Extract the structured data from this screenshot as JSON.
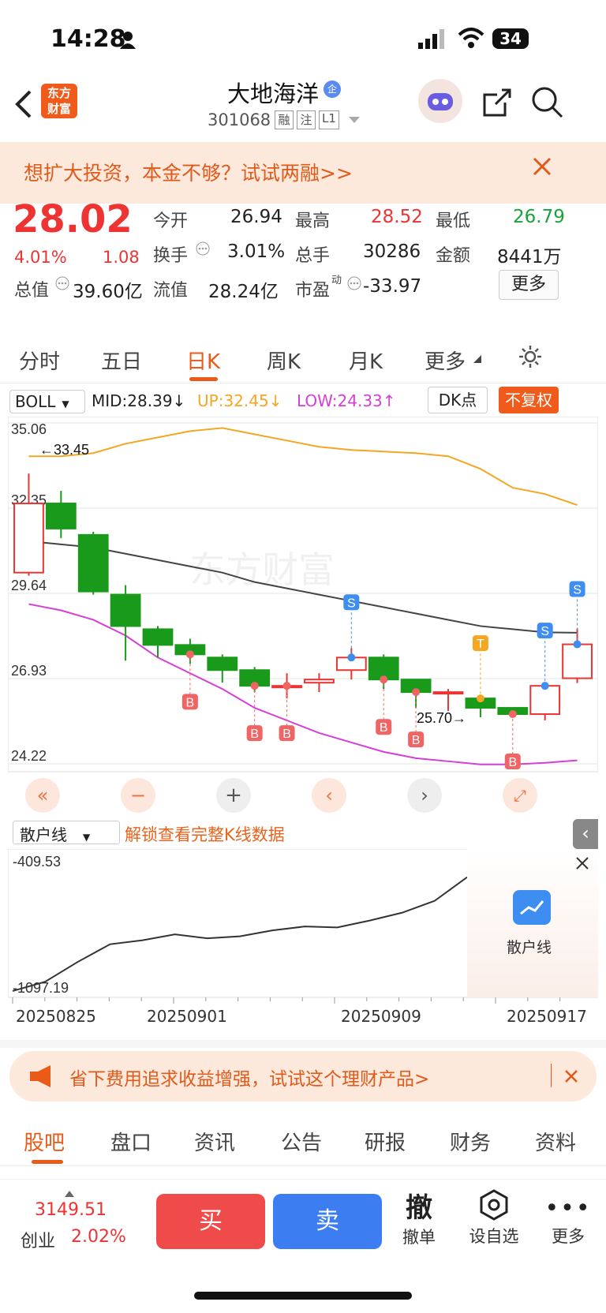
{
  "status": {
    "time": "14:28",
    "battery": "34"
  },
  "header": {
    "logo_line1": "东方",
    "logo_line2": "财富",
    "title": "大地海洋",
    "title_badge": "企",
    "code": "301068",
    "tag1": "融",
    "tag2": "注",
    "tag3": "L1"
  },
  "banner": {
    "text": "想扩大投资，本金不够？试试两融>>"
  },
  "quote": {
    "price": "28.02",
    "pct": "4.01%",
    "chg": "1.08",
    "open_label": "今开",
    "open": "26.94",
    "high_label": "最高",
    "high": "28.52",
    "low_label": "最低",
    "low": "26.79",
    "turnover_label": "换手",
    "turnover": "3.01%",
    "volume_label": "总手",
    "volume": "30286",
    "amount_label": "金额",
    "amount": "8441万",
    "mcap_label": "总值",
    "mcap": "39.60亿",
    "float_label": "流值",
    "float": "28.24亿",
    "pe_label": "市盈",
    "pe_sup": "动",
    "pe": "-33.97",
    "more": "更多"
  },
  "tabs": [
    "分时",
    "五日",
    "日K",
    "周K",
    "月K",
    "更多"
  ],
  "indicator": {
    "name": "BOLL",
    "mid": "MID:28.39↓",
    "up": "UP:32.45↓",
    "low": "LOW:24.33↑",
    "dk": "DK点",
    "fq": "不复权"
  },
  "chart_data": {
    "type": "candlestick",
    "title": "",
    "watermark": "东方财富",
    "ylim": [
      24.22,
      35.06
    ],
    "yticks": [
      "35.06",
      "32.35",
      "29.64",
      "26.93",
      "24.22"
    ],
    "annotations": [
      "←33.45",
      "25.70→"
    ],
    "candles": [
      {
        "o": 30.3,
        "c": 32.5,
        "h": 33.45,
        "l": 30.2
      },
      {
        "o": 32.5,
        "c": 31.7,
        "h": 32.9,
        "l": 31.4
      },
      {
        "o": 31.5,
        "c": 29.7,
        "h": 31.6,
        "l": 29.6
      },
      {
        "o": 29.6,
        "c": 28.6,
        "h": 29.9,
        "l": 27.5
      },
      {
        "o": 28.5,
        "c": 28.0,
        "h": 28.6,
        "l": 27.6
      },
      {
        "o": 28.0,
        "c": 27.7,
        "h": 28.2,
        "l": 27.4
      },
      {
        "o": 27.6,
        "c": 27.2,
        "h": 27.7,
        "l": 26.8
      },
      {
        "o": 27.2,
        "c": 26.7,
        "h": 27.3,
        "l": 26.5
      },
      {
        "o": 26.7,
        "c": 26.7,
        "h": 27.1,
        "l": 26.3
      },
      {
        "o": 26.8,
        "c": 26.9,
        "h": 27.1,
        "l": 26.5
      },
      {
        "o": 27.2,
        "c": 27.6,
        "h": 27.9,
        "l": 26.9
      },
      {
        "o": 27.6,
        "c": 26.9,
        "h": 27.7,
        "l": 26.6
      },
      {
        "o": 26.9,
        "c": 26.5,
        "h": 26.9,
        "l": 26.0
      },
      {
        "o": 26.5,
        "c": 26.5,
        "h": 26.6,
        "l": 25.9
      },
      {
        "o": 26.3,
        "c": 26.0,
        "h": 26.4,
        "l": 25.7
      },
      {
        "o": 26.0,
        "c": 25.8,
        "h": 26.0,
        "l": 25.7
      },
      {
        "o": 25.8,
        "c": 26.7,
        "h": 26.8,
        "l": 25.6
      },
      {
        "o": 26.94,
        "c": 28.02,
        "h": 28.52,
        "l": 26.79
      }
    ],
    "upper": [
      34.0,
      34.0,
      34.1,
      34.4,
      34.6,
      34.8,
      34.9,
      34.7,
      34.5,
      34.3,
      34.2,
      34.15,
      34.1,
      34.0,
      33.6,
      33.0,
      32.8,
      32.45
    ],
    "mid": [
      31.3,
      31.2,
      31.1,
      30.9,
      30.7,
      30.5,
      30.3,
      30.0,
      29.8,
      29.6,
      29.4,
      29.2,
      29.0,
      28.8,
      28.6,
      28.5,
      28.4,
      28.39
    ],
    "lower": [
      29.3,
      29.1,
      28.8,
      28.3,
      27.6,
      27.1,
      26.6,
      26.0,
      25.6,
      25.2,
      24.9,
      24.6,
      24.4,
      24.3,
      24.2,
      24.2,
      24.25,
      24.33
    ],
    "signals": [
      {
        "i": 5,
        "t": "B"
      },
      {
        "i": 7,
        "t": "B"
      },
      {
        "i": 8,
        "t": "B"
      },
      {
        "i": 10,
        "t": "S"
      },
      {
        "i": 11,
        "t": "B"
      },
      {
        "i": 12,
        "t": "B"
      },
      {
        "i": 14,
        "t": "T"
      },
      {
        "i": 15,
        "t": "B"
      },
      {
        "i": 16,
        "t": "S"
      },
      {
        "i": 17,
        "t": "S"
      }
    ],
    "sub": {
      "name": "散户线",
      "unlock": "解锁查看完整K线数据",
      "ytop": "-409.53",
      "ybottom": "-1097.19",
      "values": [
        -1097,
        -1050,
        -950,
        -860,
        -840,
        -810,
        -830,
        -820,
        -790,
        -770,
        -775,
        -740,
        -700,
        -640,
        -520
      ],
      "card": "散户线"
    },
    "dates": [
      "20250825",
      "20250901",
      "20250909",
      "20250917"
    ]
  },
  "ad": {
    "text": "省下费用追求收益增强，试试这个理财产品>"
  },
  "bottom_tabs": [
    "股吧",
    "盘口",
    "资讯",
    "公告",
    "研报",
    "财务",
    "资料"
  ],
  "footer": {
    "index_value": "3149.51",
    "index_name": "创业",
    "index_pct": "2.02%",
    "buy": "买",
    "sell": "卖",
    "cancel_icon": "撤",
    "cancel": "撤单",
    "watch": "设自选",
    "more": "更多"
  }
}
